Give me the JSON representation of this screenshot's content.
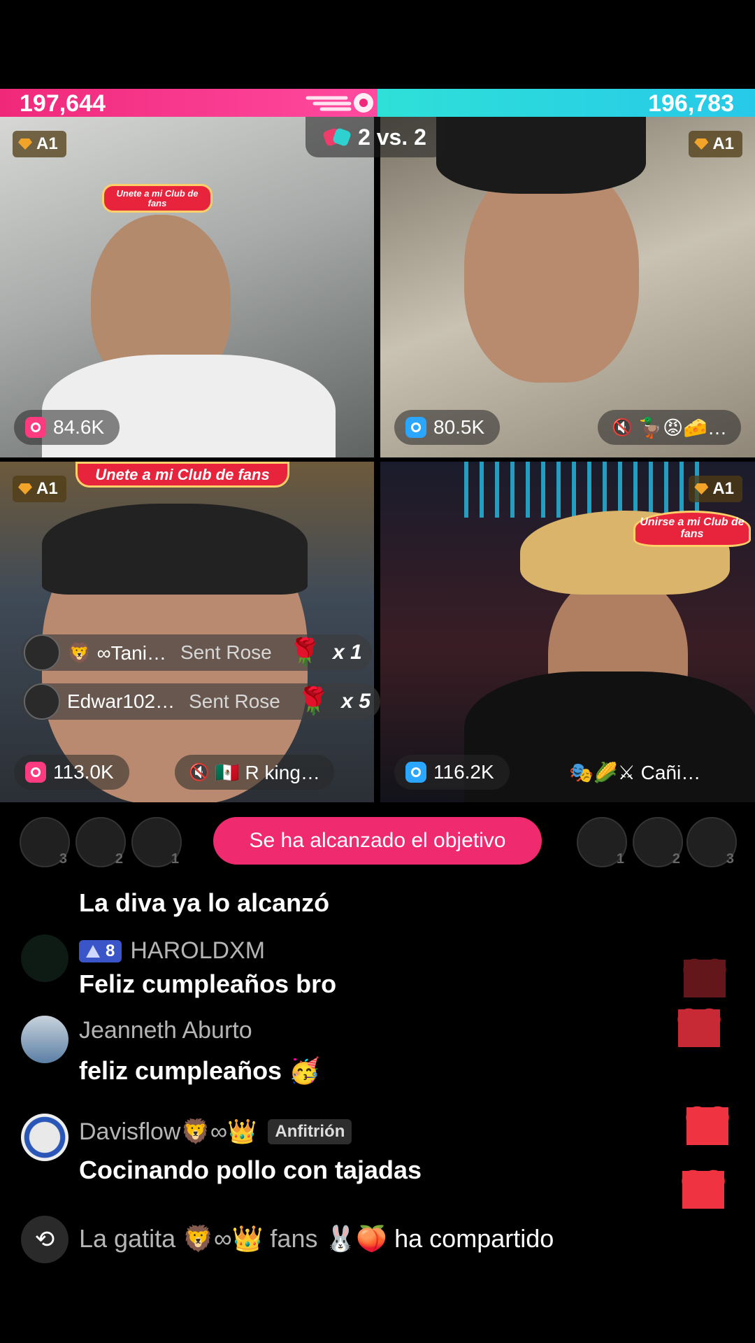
{
  "battle": {
    "left_score": "197,644",
    "right_score": "196,783",
    "mode": "2 vs. 2",
    "left_color": "#f0287a",
    "right_color": "#2ee0d8"
  },
  "tiles": [
    {
      "rank": "A1",
      "viewers": "84.6K",
      "viewer_icon_color": "#ff3b7f",
      "fanclub": "Unete a mi Club de fans"
    },
    {
      "rank": "A1",
      "viewers": "80.5K",
      "viewer_icon_color": "#2aa6ff",
      "muted_label": "🦆😡🧀…"
    },
    {
      "rank": "A1",
      "viewers": "113.0K",
      "viewer_icon_color": "#ff3b7f",
      "fanclub": "Unete a mi Club de fans",
      "muted_label": "🇲🇽 R king…"
    },
    {
      "rank": "A1",
      "viewers": "116.2K",
      "viewer_icon_color": "#2aa6ff",
      "fanclub": "Unirse a mi Club de fans",
      "guest_label": "🎭🌽⚔ Cañi…"
    }
  ],
  "gifts": [
    {
      "user": "🦁 ∞Tani…",
      "action": "Sent Rose",
      "icon": "🌹",
      "count": "x 1"
    },
    {
      "user": "Edwar102…",
      "action": "Sent Rose",
      "icon": "🌹",
      "count": "x 5"
    }
  ],
  "goal": {
    "label": "Se ha alcanzado el objetivo"
  },
  "top_left_ranks": [
    "3",
    "2",
    "1"
  ],
  "top_right_ranks": [
    "1",
    "2",
    "3"
  ],
  "chat": [
    {
      "name": "",
      "text": "La diva ya lo alcanzó"
    },
    {
      "name": "HAROLDXM",
      "level": "8",
      "text": "Feliz cumpleaños bro"
    },
    {
      "name": "Jeanneth Aburto",
      "text": "feliz cumpleaños 🥳"
    },
    {
      "name": "Davisflow🦁∞👑",
      "badge": "Anfitrión",
      "text": "Cocinando pollo con tajadas"
    }
  ],
  "share": {
    "name": "La gatita 🦁∞👑 fans 🐰🍑",
    "action": "ha compartido"
  },
  "heart_color": "#ef3340"
}
